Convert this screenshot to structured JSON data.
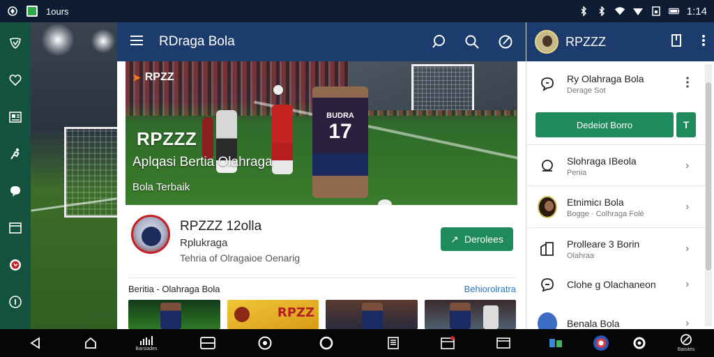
{
  "status_bar": {
    "app_label": "1ours",
    "time": "1:14"
  },
  "app": {
    "title": "RDraga Bola",
    "hero": {
      "logo_text": "RPZZ",
      "brand": "RPZZZ",
      "headline": "Aplqasi Bertia Olahraga",
      "subline": "Bola Terbaik",
      "jersey_name": "BUDRA",
      "jersey_number": "17"
    },
    "listing": {
      "name": "RPZZZ 12olla",
      "developer": "Rplukraga",
      "description": "Tehria of Olragaioe Oenarig",
      "install_label": "Derolees"
    },
    "section": {
      "title": "Beritia - Olahraga Bola",
      "link": "Behiorolratra"
    },
    "thumbnail_text": "RPZZ"
  },
  "right_panel": {
    "title": "RPZZZ",
    "header_item": {
      "title": "Ry  Olahraga Bola",
      "subtitle": "Derage Sot"
    },
    "cta_label": "Dedeiot Borro",
    "cta2_label": "T",
    "items": [
      {
        "title": "Slohraga IBeola",
        "subtitle": "Penia"
      },
      {
        "title": "Etnimicı Bola",
        "subtitle": "Bogge · Colhraga Folé"
      },
      {
        "title": "Prolleare 3 Borin",
        "subtitle": "Olahraa"
      },
      {
        "title": "Clohe  g Olachaneon",
        "subtitle": ""
      },
      {
        "title": "Benala Bola",
        "subtitle": ""
      }
    ]
  },
  "nav_bar": {
    "labels": [
      "Barsiades",
      "Baisites"
    ]
  },
  "colors": {
    "status_bar": "#0d1b33",
    "app_bar": "#1b3c6d",
    "rail": "#13523f",
    "accent_green": "#1f8a5b",
    "link_blue": "#2a78c0"
  }
}
